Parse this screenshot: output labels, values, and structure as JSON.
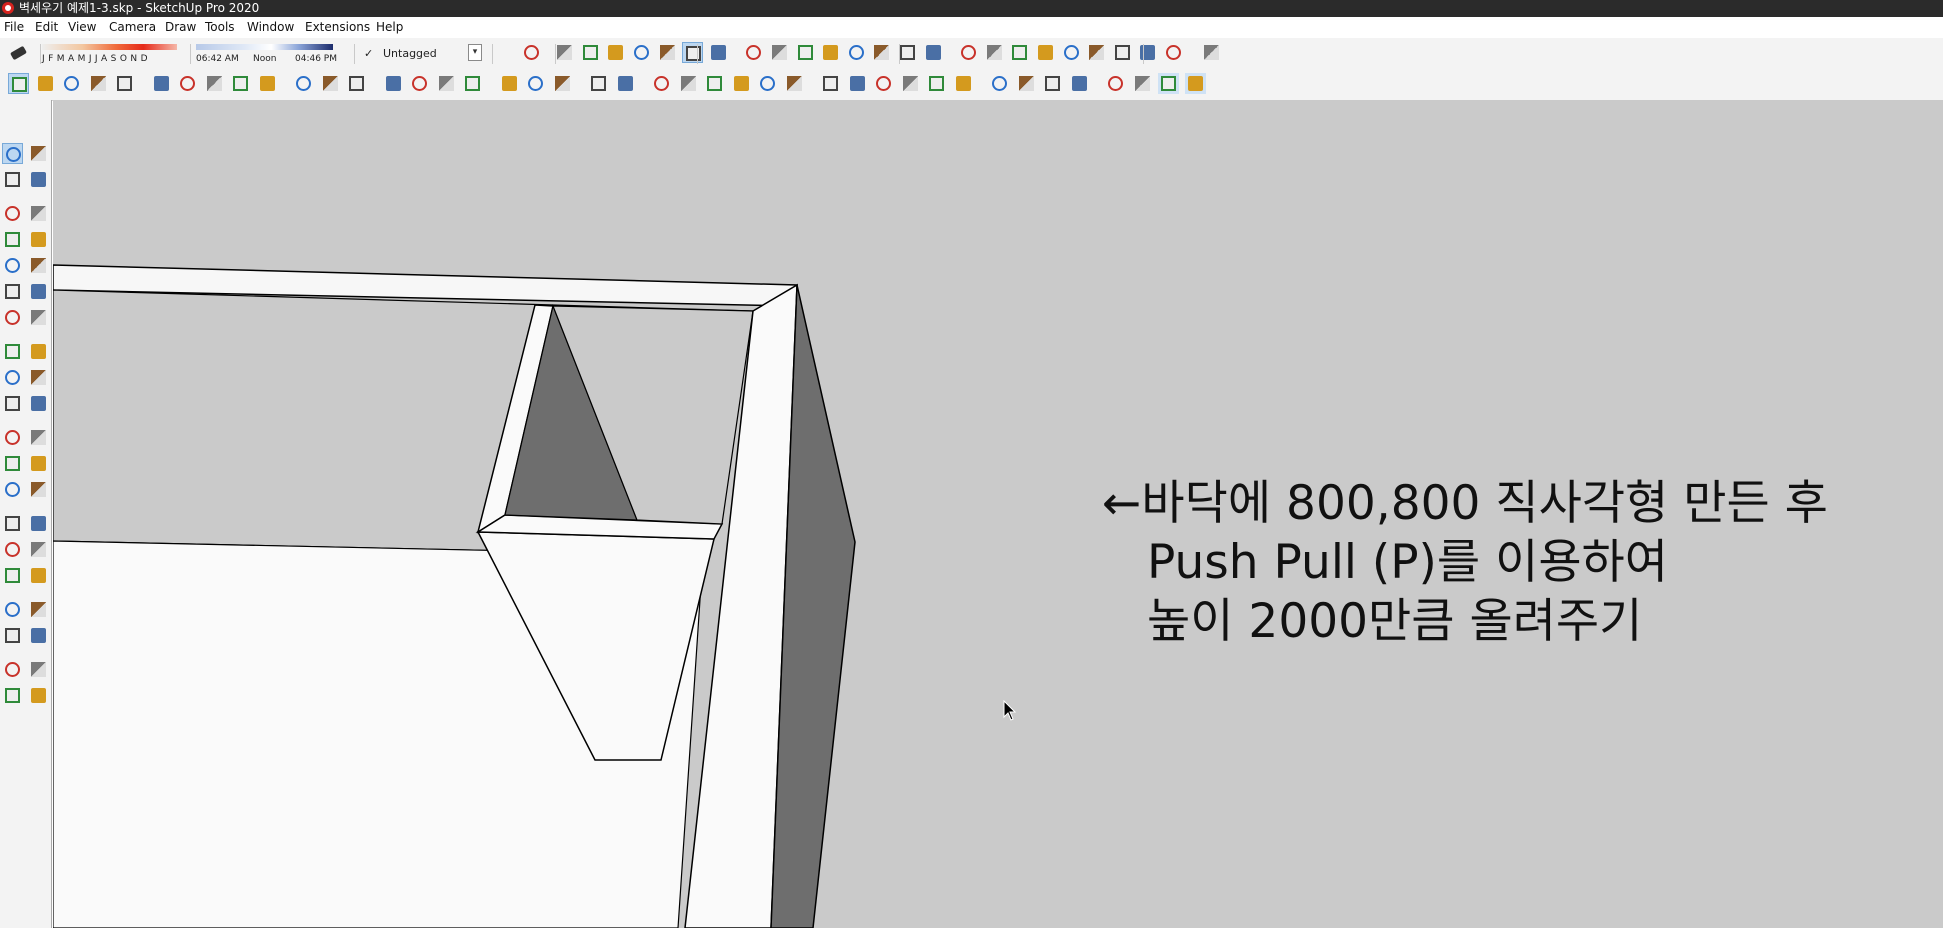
{
  "window": {
    "title": "벽세우기 예제1-3.skp - SketchUp Pro 2020"
  },
  "menu": [
    "File",
    "Edit",
    "View",
    "Camera",
    "Draw",
    "Tools",
    "Window",
    "Extensions",
    "Help"
  ],
  "shadows": {
    "months_label": "J F M A M J J A S O N D",
    "time_start": "06:42 AM",
    "time_mid": "Noon",
    "time_end": "04:46 PM"
  },
  "tag": {
    "check": "✓",
    "value": "Untagged"
  },
  "toolbar_icons_row1": [
    "eraser-icon",
    "front-view-icon",
    "back-edges-icon",
    "wireframe-icon",
    "hidden-line-icon",
    "shaded-icon",
    "shaded-textures-icon",
    "monochrome-icon",
    "xray-icon",
    "section-plane-icon",
    "section-cut-icon",
    "3d-warehouse-icon",
    "extension-warehouse-icon",
    "layout-icon",
    "styles-icon",
    "shadows-icon",
    "fog-icon",
    "orbit-icon",
    "pan-icon",
    "zoom-icon",
    "zoom-window-icon",
    "zoom-extents-icon",
    "previous-view-icon",
    "position-camera-icon",
    "look-around-icon",
    "walk-icon",
    "geo-location-icon"
  ],
  "toolbar_icons_row2": [
    "select-icon",
    "eraser-icon",
    "line-icon",
    "arc-icon",
    "rectangle-icon",
    "push-pull-icon",
    "follow-me-icon",
    "move-icon",
    "rotate-icon",
    "scale-icon",
    "tape-measure-icon",
    "text-icon",
    "paint-bucket-icon",
    "orbit-icon",
    "pan-icon",
    "zoom-icon",
    "zoom-extents-icon",
    "component-icon",
    "group-icon",
    "solid-tools-icon",
    "ruby-console-icon",
    "user-icon",
    "iso-view-icon",
    "top-view-icon",
    "front-view-icon",
    "right-view-icon",
    "back-view-icon",
    "left-view-icon",
    "outer-shell-icon",
    "intersect-icon",
    "union-icon",
    "subtract-icon",
    "trim-icon",
    "split-icon",
    "sandbox-icon",
    "drape-icon",
    "stamp-icon",
    "smoove-icon",
    "section-plane-icon",
    "xray-icon",
    "back-edges-icon",
    "wireframe-icon"
  ],
  "large_tool_set": [
    "select-icon",
    "make-component-icon",
    "paint-bucket-icon",
    "eraser-icon",
    "line-icon",
    "freehand-icon",
    "rectangle-icon",
    "rotated-rectangle-icon",
    "circle-icon",
    "polygon-icon",
    "arc-icon",
    "2pt-arc-icon",
    "3pt-arc-icon",
    "pie-icon",
    "move-icon",
    "push-pull-icon",
    "rotate-icon",
    "follow-me-icon",
    "scale-icon",
    "offset-icon",
    "tape-measure-icon",
    "dimension-icon",
    "protractor-icon",
    "text-icon",
    "axes-icon",
    "3d-text-icon",
    "orbit-icon",
    "pan-icon",
    "zoom-icon",
    "zoom-window-icon",
    "zoom-extents-icon",
    "previous-icon",
    "position-camera-icon",
    "look-around-icon",
    "walk-icon",
    "section-plane-icon",
    "3d-warehouse-icon",
    "extension-warehouse-icon",
    "layout-icon",
    "send-to-layout-icon"
  ],
  "annotation": {
    "line1": "←바닥에 800,800 직사각형 만든 후",
    "line2": "Push Pull (P)를 이용하여",
    "line3": "높이 2000만큼 올려주기"
  },
  "colors": {
    "viewport_background": "#cacaca",
    "face_light": "#fafafa",
    "face_dark": "#6e6e6e",
    "edge": "#000000",
    "selection_blue": "#bcd7f1"
  }
}
